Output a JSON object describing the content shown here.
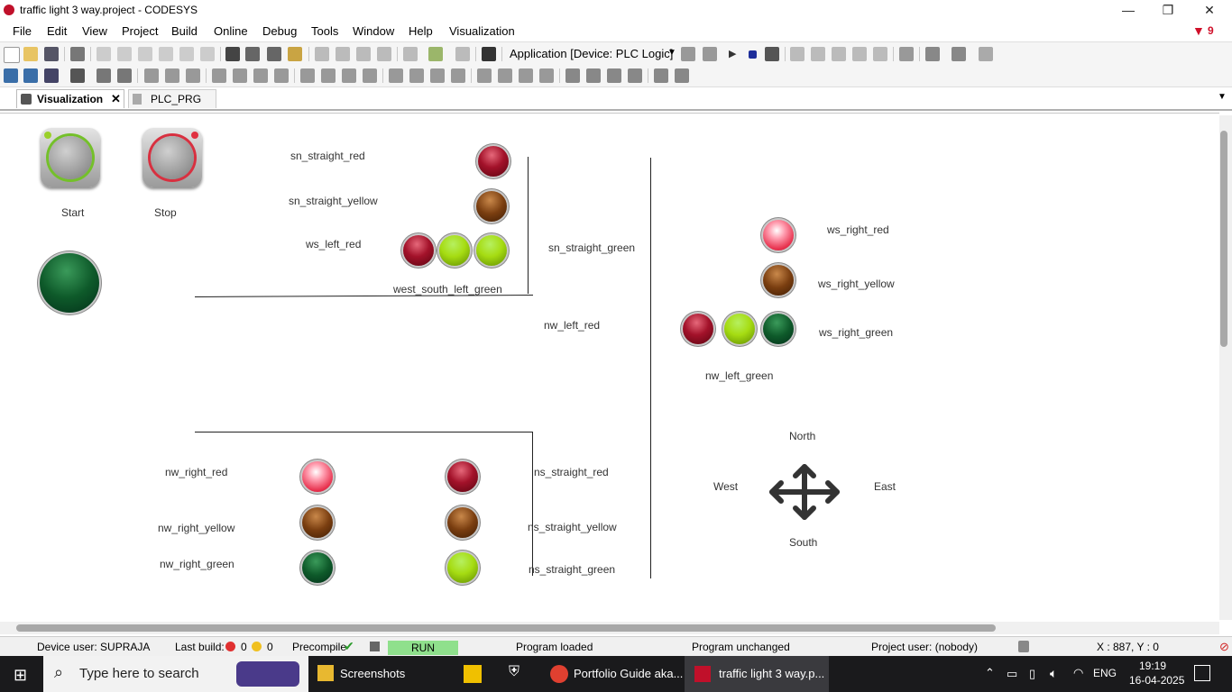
{
  "window": {
    "title": "traffic light 3 way.project - CODESYS",
    "minimize": "—",
    "maximize": "❐",
    "close": "✕"
  },
  "menu": {
    "items": [
      "File",
      "Edit",
      "View",
      "Project",
      "Build",
      "Online",
      "Debug",
      "Tools",
      "Window",
      "Help",
      "Visualization"
    ],
    "error_count": "9"
  },
  "toolbar": {
    "application": "Application [Device: PLC Logic]"
  },
  "tabs": [
    {
      "label": "Visualization",
      "active": true
    },
    {
      "label": "PLC_PRG",
      "active": false
    }
  ],
  "visu": {
    "start_label": "Start",
    "stop_label": "Stop",
    "labels": {
      "sn_straight_red": "sn_straight_red",
      "sn_straight_yellow": "sn_straight_yellow",
      "ws_left_red": "ws_left_red",
      "sn_straight_green": "sn_straight_green",
      "west_south_left_green": "west_south_left_green",
      "nw_left_red": "nw_left_red",
      "ws_right_red": "ws_right_red",
      "ws_right_yellow": "ws_right_yellow",
      "ws_right_green": "ws_right_green",
      "nw_left_green": "nw_left_green",
      "nw_right_red": "nw_right_red",
      "nw_right_yellow": "nw_right_yellow",
      "nw_right_green": "nw_right_green",
      "ns_straight_red": "ns_straight_red",
      "ns_straight_yellow": "ns_straight_yellow",
      "ns_straight_green": "ns_straight_green"
    },
    "compass": {
      "north": "North",
      "south": "South",
      "east": "East",
      "west": "West"
    }
  },
  "status": {
    "device_user": "Device user: SUPRAJA",
    "last_build": "Last build:",
    "errors": "0",
    "warnings": "0",
    "precompile": "Precompile",
    "run": "RUN",
    "program_loaded": "Program loaded",
    "program_unchanged": "Program unchanged",
    "project_user": "Project user: (nobody)",
    "coords": "X : 887, Y : 0"
  },
  "taskbar": {
    "search_placeholder": "Type here to search",
    "apps": [
      "Screenshots",
      "Portfolio Guide aka...",
      "traffic light 3 way.p..."
    ],
    "lang": "ENG",
    "time": "19:19",
    "date": "16-04-2025"
  }
}
